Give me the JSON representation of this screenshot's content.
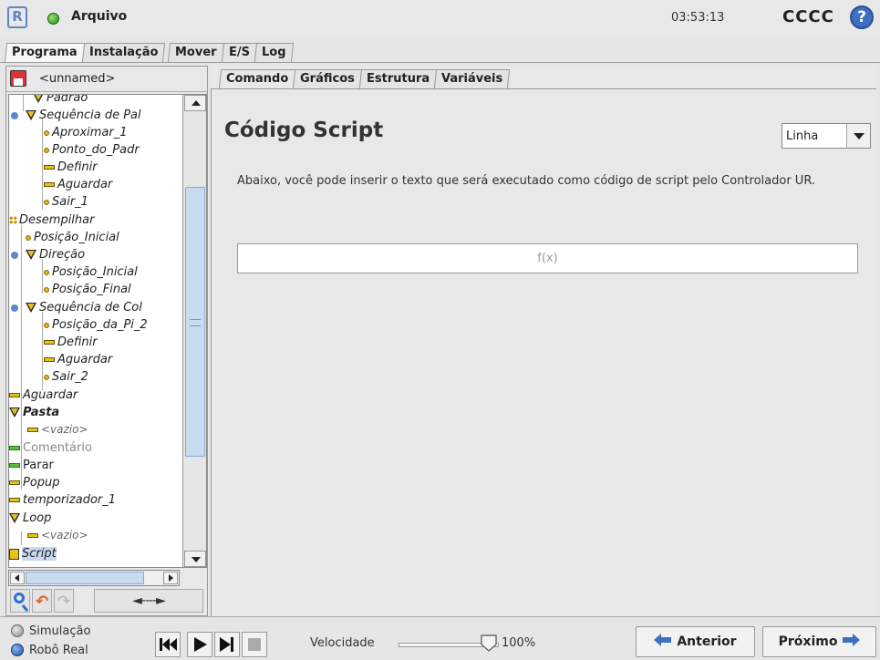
{
  "topbar": {
    "file_menu": "Arquivo",
    "clock": "03:53:13",
    "robot_name": "CCCC",
    "help": "?"
  },
  "main_tabs": [
    "Programa",
    "Instalação",
    "Mover",
    "E/S",
    "Log"
  ],
  "program": {
    "name": "<unnamed>"
  },
  "tree": [
    {
      "label": "Padrão",
      "icon": "folder-open-icon"
    },
    {
      "label": "Sequência de Pal",
      "icon": "folder-open-icon"
    },
    {
      "label": "Aproximar_1",
      "icon": "waypoint-icon"
    },
    {
      "label": "Ponto_do_Padr",
      "icon": "waypoint-icon"
    },
    {
      "label": "Definir",
      "icon": "command-icon"
    },
    {
      "label": "Aguardar",
      "icon": "command-icon"
    },
    {
      "label": "Sair_1",
      "icon": "waypoint-icon"
    },
    {
      "label": "Desempilhar",
      "icon": "pallet-icon"
    },
    {
      "label": "Posição_Inicial",
      "icon": "waypoint-icon"
    },
    {
      "label": "Direção",
      "icon": "folder-open-icon"
    },
    {
      "label": "Posição_Inicial",
      "icon": "waypoint-icon"
    },
    {
      "label": "Posição_Final",
      "icon": "waypoint-icon"
    },
    {
      "label": "Sequência de Col",
      "icon": "folder-open-icon"
    },
    {
      "label": "Posição_da_Pi_2",
      "icon": "waypoint-icon"
    },
    {
      "label": "Definir",
      "icon": "command-icon"
    },
    {
      "label": "Aguardar",
      "icon": "command-icon"
    },
    {
      "label": "Sair_2",
      "icon": "waypoint-icon"
    },
    {
      "label": "Aguardar",
      "icon": "command-icon"
    },
    {
      "label": "Pasta",
      "icon": "folder-open-icon"
    },
    {
      "label": "<vazio>",
      "icon": "command-icon"
    },
    {
      "label": "Comentário",
      "icon": "command-icon"
    },
    {
      "label": "Parar",
      "icon": "command-icon"
    },
    {
      "label": "Popup",
      "icon": "command-icon"
    },
    {
      "label": "temporizador_1",
      "icon": "command-icon"
    },
    {
      "label": "Loop",
      "icon": "folder-open-icon"
    },
    {
      "label": "<vazio>",
      "icon": "command-icon"
    },
    {
      "label": "Script",
      "icon": "script-icon"
    }
  ],
  "tools": {
    "move_label": "◄----►"
  },
  "sub_tabs": [
    "Comando",
    "Gráficos",
    "Estrutura",
    "Variáveis"
  ],
  "content": {
    "title": "Código Script",
    "mode_select": {
      "value": "Linha"
    },
    "description": "Abaixo, você pode inserir o texto que será executado como código de script pelo Controlador UR.",
    "script_placeholder": "f(x)"
  },
  "bottom": {
    "sim_label": "Simulação",
    "real_label": "Robô Real",
    "selected_mode": "Robô Real",
    "speed_label": "Velocidade",
    "speed_value": "100%",
    "speed_fraction": 1.0,
    "prev_label": "Anterior",
    "next_label": "Próximo"
  },
  "colors": {
    "accent": "#3f6fc1",
    "status": "#4fc23a",
    "selection": "#c8d8f0",
    "waypoint": "#e2b31d"
  }
}
